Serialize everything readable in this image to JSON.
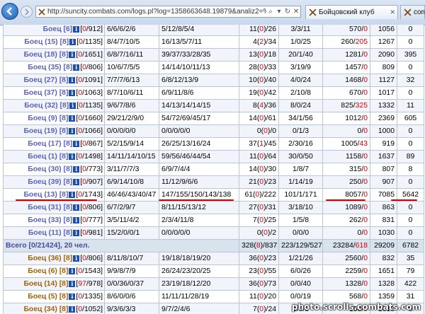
{
  "browser": {
    "url": "http://suncity.combats.com/logs.pl?log=1358663648.19879&analiz2=%D1%F2%E0%F2%",
    "tabs": [
      {
        "label": "Бойцовский клуб"
      },
      {
        "label": "combats"
      }
    ]
  },
  "table": {
    "rows": [
      {
        "name": "Боец",
        "lvl": "6",
        "side": "blue",
        "hp": "0",
        "hpmax": "912",
        "c2": "6/6/6/2/6",
        "c3": "5/12/8/5/4",
        "c4a": "11",
        "c4b": "0",
        "c4c": "26",
        "c5": "3/3/11",
        "c6a": "570",
        "c6b": "0",
        "c7": "1056",
        "c8": "0"
      },
      {
        "name": "Боец (15)",
        "lvl": "8",
        "side": "blue",
        "hp": "0",
        "hpmax": "1135",
        "c2": "8/4/7/10/5",
        "c3": "16/13/5/7/11",
        "c4a": "4",
        "c4b": "2",
        "c4c": "34",
        "c5": "1/0/25",
        "c6a": "260",
        "c6b": "205",
        "c7": "1267",
        "c8": "0"
      },
      {
        "name": "Боец (18)",
        "lvl": "8",
        "side": "blue",
        "hp": "0",
        "hpmax": "1651",
        "c2": "6/8/7/16/11",
        "c3": "39/37/33/28/35",
        "c4a": "13",
        "c4b": "0",
        "c4c": "18",
        "c5": "20/1/40",
        "c6a": "1281",
        "c6b": "0",
        "c7": "2090",
        "c8": "395"
      },
      {
        "name": "Боец (35)",
        "lvl": "8",
        "side": "blue",
        "hp": "0",
        "hpmax": "806",
        "c2": "10/6/7/5/5",
        "c3": "14/14/10/11/13",
        "c4a": "28",
        "c4b": "0",
        "c4c": "33",
        "c5": "3/19/9",
        "c6a": "1457",
        "c6b": "0",
        "c7": "809",
        "c8": "0"
      },
      {
        "name": "Боец (27)",
        "lvl": "8",
        "side": "blue",
        "hp": "0",
        "hpmax": "1091",
        "c2": "7/7/7/6/13",
        "c3": "6/8/12/13/9",
        "c4a": "10",
        "c4b": "0",
        "c4c": "40",
        "c5": "4/0/24",
        "c6a": "1468",
        "c6b": "0",
        "c7": "1127",
        "c8": "32"
      },
      {
        "name": "Боец (37)",
        "lvl": "8",
        "side": "blue",
        "hp": "0",
        "hpmax": "1063",
        "c2": "8/7/10/6/11",
        "c3": "6/9/11/8/6",
        "c4a": "19",
        "c4b": "0",
        "c4c": "42",
        "c5": "2/10/8",
        "c6a": "670",
        "c6b": "0",
        "c7": "1017",
        "c8": "0"
      },
      {
        "name": "Боец (32)",
        "lvl": "8",
        "side": "blue",
        "hp": "0",
        "hpmax": "1135",
        "c2": "9/6/7/8/6",
        "c3": "14/13/14/14/15",
        "c4a": "8",
        "c4b": "4",
        "c4c": "36",
        "c5": "8/0/24",
        "c6a": "825",
        "c6b": "325",
        "c7": "1332",
        "c8": "11"
      },
      {
        "name": "Боец (9)",
        "lvl": "8",
        "side": "blue",
        "hp": "0",
        "hpmax": "1660",
        "c2": "29/21/2/9/0",
        "c3": "54/72/69/45/17",
        "c4a": "14",
        "c4b": "0",
        "c4c": "61",
        "c5": "34/1/56",
        "c6a": "1012",
        "c6b": "0",
        "c7": "2369",
        "c8": "605"
      },
      {
        "name": "Боец (19)",
        "lvl": "8",
        "side": "blue",
        "hp": "0",
        "hpmax": "1066",
        "c2": "0/0/0/0/0",
        "c3": "0/0/0/0/0",
        "c4a": "0",
        "c4b": "0",
        "c4c": "0",
        "c5": "0/1/3",
        "c6a": "0",
        "c6b": "0",
        "c7": "1000",
        "c8": "0"
      },
      {
        "name": "Боец (17)",
        "lvl": "8",
        "side": "blue",
        "hp": "0",
        "hpmax": "867",
        "c2": "5/2/15/9/14",
        "c3": "26/25/13/16/24",
        "c4a": "37",
        "c4b": "1",
        "c4c": "45",
        "c5": "2/30/16",
        "c6a": "1005",
        "c6b": "43",
        "c7": "919",
        "c8": "0"
      },
      {
        "name": "Боец (1)",
        "lvl": "8",
        "side": "blue",
        "hp": "0",
        "hpmax": "1498",
        "c2": "14/11/14/10/15",
        "c3": "59/56/46/44/54",
        "c4a": "11",
        "c4b": "0",
        "c4c": "64",
        "c5": "30/0/50",
        "c6a": "1158",
        "c6b": "0",
        "c7": "1637",
        "c8": "89"
      },
      {
        "name": "Боец (30)",
        "lvl": "8",
        "side": "blue",
        "hp": "0",
        "hpmax": "773",
        "c2": "3/11/7/7/3",
        "c3": "6/9/7/4/4",
        "c4a": "14",
        "c4b": "0",
        "c4c": "30",
        "c5": "1/8/7",
        "c6a": "315",
        "c6b": "0",
        "c7": "807",
        "c8": "8"
      },
      {
        "name": "Боец (39)",
        "lvl": "8",
        "side": "blue",
        "hp": "0",
        "hpmax": "907",
        "c2": "6/9/14/10/8",
        "c3": "11/12/9/6/6",
        "c4a": "21",
        "c4b": "0",
        "c4c": "23",
        "c5": "1/14/19",
        "c6a": "250",
        "c6b": "0",
        "c7": "907",
        "c8": "0"
      },
      {
        "name": "Боец (13)",
        "lvl": "8",
        "side": "blue",
        "hp": "0",
        "hpmax": "1743",
        "c2": "46/46/43/40/47",
        "c3": "147/155/150/143/138",
        "c4a": "61",
        "c4b": "0",
        "c4c": "222",
        "c5": "101/1/171",
        "c6a": "8057",
        "c6b": "0",
        "c7": "7085",
        "c8": "5642"
      },
      {
        "name": "Боец (31)",
        "lvl": "8",
        "side": "blue",
        "hp": "0",
        "hpmax": "806",
        "c2": "6/7/2/9/7",
        "c3": "8/11/15/13/12",
        "c4a": "27",
        "c4b": "0",
        "c4c": "31",
        "c5": "3/18/10",
        "c6a": "1089",
        "c6b": "0",
        "c7": "863",
        "c8": "0"
      },
      {
        "name": "Боец (33)",
        "lvl": "8",
        "side": "blue",
        "hp": "0",
        "hpmax": "777",
        "c2": "3/5/11/4/2",
        "c3": "2/3/4/11/8",
        "c4a": "7",
        "c4b": "0",
        "c4c": "25",
        "c5": "1/5/8",
        "c6a": "262",
        "c6b": "0",
        "c7": "831",
        "c8": "0"
      },
      {
        "name": "Боец (11)",
        "lvl": "8",
        "side": "blue",
        "hp": "0",
        "hpmax": "981",
        "c2": "15/2/0/0/1",
        "c3": "0/0/0/0/0",
        "c4a": "0",
        "c4b": "0",
        "c4c": "2",
        "c5": "0/0/0",
        "c6a": "0",
        "c6b": "0",
        "c7": "1030",
        "c8": "0"
      },
      {
        "name": "Боец (36)",
        "lvl": "8",
        "side": "orange",
        "hp": "0",
        "hpmax": "806",
        "c2": "8/11/8/10/7",
        "c3": "19/18/18/19/20",
        "c4a": "36",
        "c4b": "0",
        "c4c": "23",
        "c5": "1/21/26",
        "c6a": "2560",
        "c6b": "0",
        "c7": "832",
        "c8": "35"
      },
      {
        "name": "Боец (6)",
        "lvl": "8",
        "side": "orange",
        "hp": "0",
        "hpmax": "1543",
        "c2": "9/9/8/7/9",
        "c3": "26/24/23/20/25",
        "c4a": "23",
        "c4b": "0",
        "c4c": "55",
        "c5": "6/0/26",
        "c6a": "2259",
        "c6b": "0",
        "c7": "1651",
        "c8": "79"
      },
      {
        "name": "Боец (14)",
        "lvl": "8",
        "side": "orange",
        "hp": "97",
        "hpmax": "978",
        "c2": "0/0/36/0/37",
        "c3": "23/19/18/12/20",
        "c4a": "36",
        "c4b": "0",
        "c4c": "73",
        "c5": "0/0/40",
        "c6a": "1328",
        "c6b": "0",
        "c7": "1328",
        "c8": "422"
      },
      {
        "name": "Боец (5)",
        "lvl": "8",
        "side": "orange",
        "hp": "0",
        "hpmax": "1335",
        "c2": "8/6/0/0/6",
        "c3": "11/11/11/28/19",
        "c4a": "11",
        "c4b": "0",
        "c4c": "20",
        "c5": "0/0/19",
        "c6a": "568",
        "c6b": "0",
        "c7": "1359",
        "c8": "31"
      },
      {
        "name": "Боец (34)",
        "lvl": "8",
        "side": "orange",
        "hp": "0",
        "hpmax": "1052",
        "c2": "9/3/6/3/3",
        "c3": "9/7/2/4/6",
        "c4a": "7",
        "c4b": "0",
        "c4c": "24",
        "c5": "1/0/8",
        "c6a": "158",
        "c6b": "0",
        "c7": "1010",
        "c8": "0"
      },
      {
        "name": "Боец",
        "lvl": "7",
        "side": "orange",
        "hp": "0",
        "hpmax": "",
        "c2": "",
        "c3": "",
        "c4a": "",
        "c4b": "",
        "c4c": "",
        "c5": "",
        "c6a": "",
        "c6b": "",
        "c7": "",
        "c8": ""
      }
    ],
    "total_row_index": 17,
    "total": {
      "label": "Всего [0/21424], 20 чел.",
      "c4a": "328",
      "c4b": "8",
      "c4c": "837",
      "c5": "223/129/527",
      "c6a": "23284",
      "c6b": "618",
      "c7": "29209",
      "c8": "6782"
    }
  },
  "watermark": "photo.scrolls.combats.com",
  "colors": {
    "accent_red": "#d40000",
    "blue_team": "#5a64b8",
    "orange_team": "#a0620c",
    "total_bg": "#d9e3ee"
  }
}
